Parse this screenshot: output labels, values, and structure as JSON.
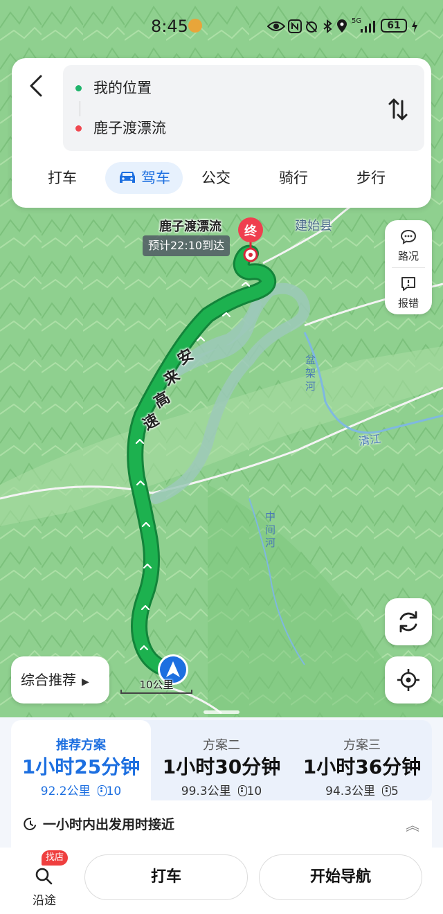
{
  "status_bar": {
    "time": "8:45",
    "network": "5G",
    "battery": "61"
  },
  "route": {
    "origin": "我的位置",
    "destination": "鹿子渡漂流",
    "origin_color": "#1fb46b",
    "destination_color": "#f0474f"
  },
  "modes": [
    "打车",
    "驾车",
    "公交",
    "骑行",
    "步行"
  ],
  "active_mode_index": 1,
  "map": {
    "dest_name": "鹿子渡漂流",
    "end_marker": "终",
    "eta": "预计22:10到达",
    "town": "建始县",
    "highway": [
      "安",
      "来",
      "高",
      "速"
    ],
    "rivers": {
      "panjia": "盆架河",
      "qingjiang": "清江",
      "zhongjian": "中间河"
    },
    "scale": "10公里",
    "route_color": "#1aa84a"
  },
  "side": {
    "traffic": "路况",
    "report": "报错"
  },
  "strategy": "综合推荐",
  "plans": [
    {
      "name": "推荐方案",
      "duration": "1小时25分钟",
      "distance": "92.2公里",
      "lights": "10"
    },
    {
      "name": "方案二",
      "duration": "1小时30分钟",
      "distance": "99.3公里",
      "lights": "10"
    },
    {
      "name": "方案三",
      "duration": "1小时36分钟",
      "distance": "94.3公里",
      "lights": "5"
    }
  ],
  "tip": "一小时内出发用时接近",
  "bottom": {
    "along_label": "沿途",
    "shop_badge": "找店",
    "taxi": "打车",
    "navigate": "开始导航"
  }
}
